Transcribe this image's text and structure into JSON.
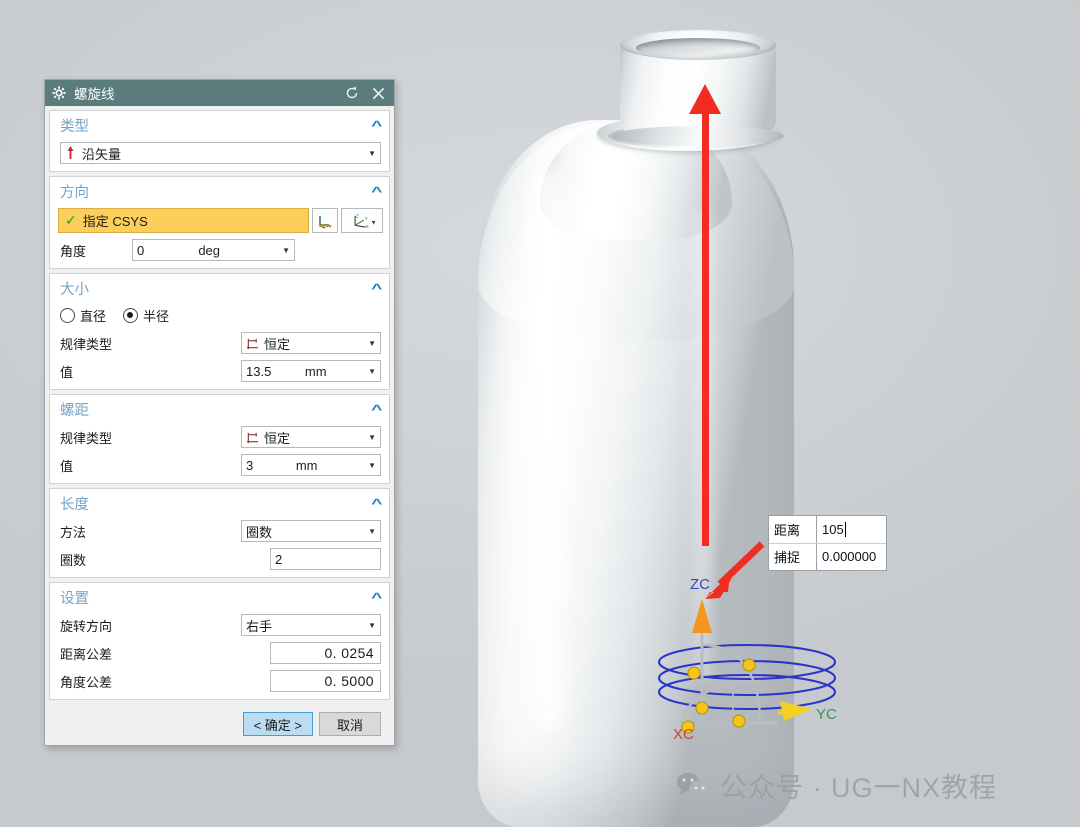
{
  "viewport": {
    "model_name": "bottle",
    "distance_box": {
      "distance_label": "距离",
      "distance_value": "105",
      "snap_label": "捕捉",
      "snap_value": "0.000000"
    },
    "axes": {
      "z": "ZC",
      "y": "YC",
      "x": "XC"
    },
    "watermark": "公众号 · UG一NX教程"
  },
  "dialog": {
    "title": "螺旋线",
    "icons": {
      "gear": "gear-icon",
      "reset": "reset-icon",
      "close": "close-icon"
    },
    "sections": {
      "type": {
        "title": "类型",
        "value": "沿矢量"
      },
      "direction": {
        "title": "方向",
        "csys_label": "指定 CSYS",
        "angle_label": "角度",
        "angle_value": "0",
        "angle_unit": "deg"
      },
      "size": {
        "title": "大小",
        "radio_diameter": "直径",
        "radio_radius": "半径",
        "law_label": "规律类型",
        "law_value": "恒定",
        "value_label": "值",
        "value": "13.5",
        "unit": "mm"
      },
      "pitch": {
        "title": "螺距",
        "law_label": "规律类型",
        "law_value": "恒定",
        "value_label": "值",
        "value": "3",
        "unit": "mm"
      },
      "length": {
        "title": "长度",
        "method_label": "方法",
        "method_value": "圈数",
        "turns_label": "圈数",
        "turns_value": "2"
      },
      "settings": {
        "title": "设置",
        "rotation_label": "旋转方向",
        "rotation_value": "右手",
        "dist_tol_label": "距离公差",
        "dist_tol_value": "0. 0254",
        "ang_tol_label": "角度公差",
        "ang_tol_value": "0. 5000"
      }
    },
    "buttons": {
      "ok": "< 确定 >",
      "cancel": "取消"
    }
  },
  "colors": {
    "titlebar": "#5a7c7d",
    "section_header": "#74a4c6",
    "highlight": "#fccf5c",
    "accent_red": "#f22c20",
    "ok_button": "#bcdcf2"
  }
}
